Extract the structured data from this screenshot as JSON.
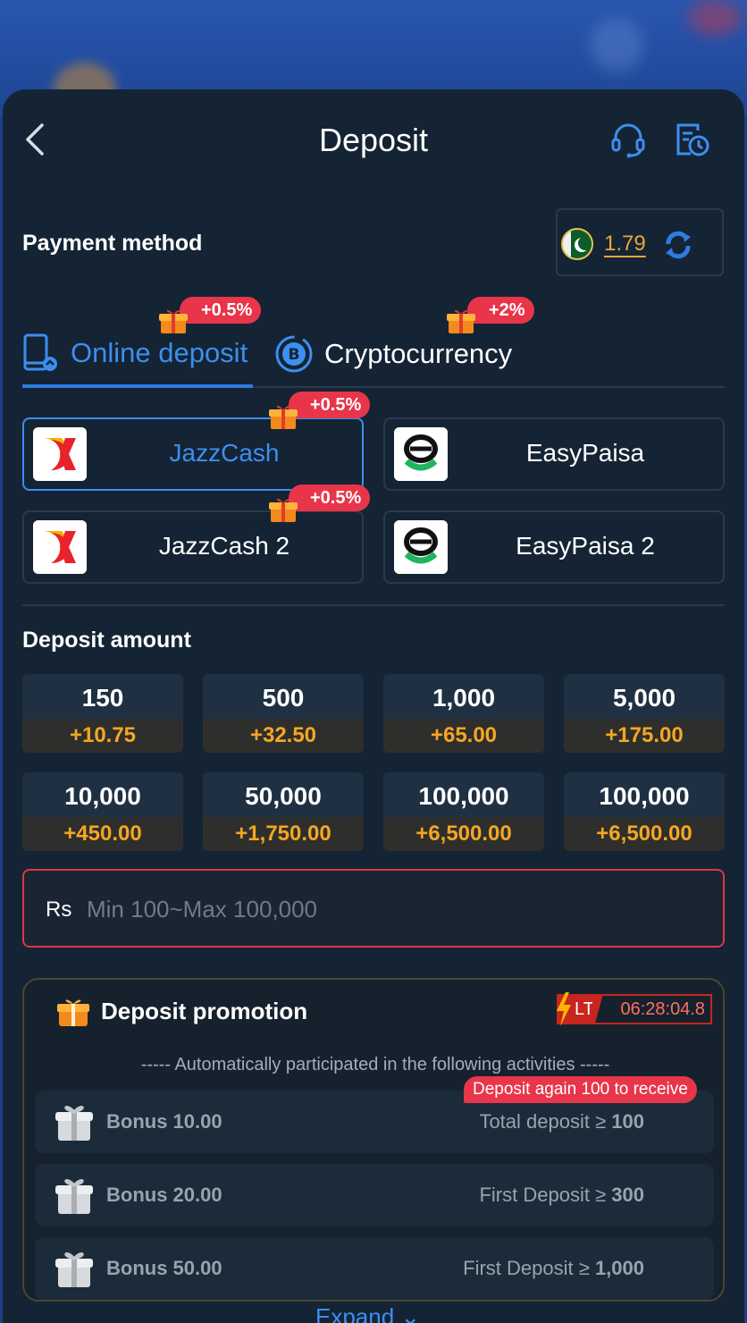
{
  "header": {
    "title": "Deposit"
  },
  "payment_method": {
    "label": "Payment method",
    "balance": "1.79"
  },
  "tabs": [
    {
      "label": "Online deposit",
      "badge": "+0.5%"
    },
    {
      "label": "Cryptocurrency",
      "badge": "+2%"
    }
  ],
  "methods": [
    {
      "name": "JazzCash",
      "badge": "+0.5%",
      "selected": true
    },
    {
      "name": "EasyPaisa",
      "badge": ""
    },
    {
      "name": "JazzCash 2",
      "badge": "+0.5%"
    },
    {
      "name": "EasyPaisa 2",
      "badge": ""
    }
  ],
  "deposit_amount": {
    "label": "Deposit amount",
    "options": [
      {
        "amount": "150",
        "bonus": "+10.75"
      },
      {
        "amount": "500",
        "bonus": "+32.50"
      },
      {
        "amount": "1,000",
        "bonus": "+65.00"
      },
      {
        "amount": "5,000",
        "bonus": "+175.00"
      },
      {
        "amount": "10,000",
        "bonus": "+450.00"
      },
      {
        "amount": "50,000",
        "bonus": "+1,750.00"
      },
      {
        "amount": "100,000",
        "bonus": "+6,500.00"
      },
      {
        "amount": "100,000",
        "bonus": "+6,500.00"
      }
    ],
    "currency": "Rs",
    "placeholder": "Min 100~Max 100,000"
  },
  "promotion": {
    "title": "Deposit promotion",
    "lt_label": "LT",
    "countdown": "06:28:04.8",
    "subtitle": "----- Automatically participated in the following activities -----",
    "again_badge": "Deposit again 100 to receive",
    "bonuses": [
      {
        "name": "Bonus 10.00",
        "req_label": "Total deposit ≥",
        "req_value": "100"
      },
      {
        "name": "Bonus 20.00",
        "req_label": "First Deposit ≥",
        "req_value": "300"
      },
      {
        "name": "Bonus 50.00",
        "req_label": "First Deposit ≥",
        "req_value": "1,000"
      }
    ],
    "expand_label": "Expand"
  },
  "colors": {
    "accent": "#3d8ef0",
    "badge": "#e8354a",
    "bonus": "#f5a623",
    "sheet": "#142434"
  }
}
